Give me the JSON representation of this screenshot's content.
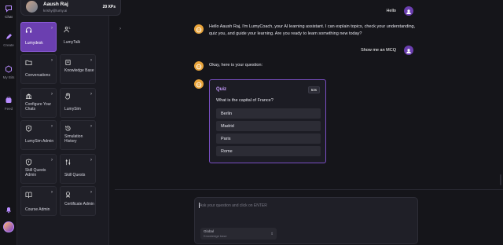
{
  "rail": {
    "items": [
      {
        "icon": "chat-icon",
        "label": "Chat"
      },
      {
        "icon": "pen-icon",
        "label": "Create"
      },
      {
        "icon": "cube-icon",
        "label": "My Bits"
      },
      {
        "icon": "feed-icon",
        "label": "Feed"
      }
    ],
    "accent": "#a970ff"
  },
  "user": {
    "name": "Aaush Raj",
    "handle": "krishy@lumy.ai",
    "xp": "20 XPs"
  },
  "tiles": [
    {
      "label": "Lumydesk",
      "icon": "headphones-icon",
      "active": true
    },
    {
      "label": "LumyTalk",
      "icon": "person-talk-icon"
    },
    {
      "label": "Conversations",
      "icon": "folder-icon"
    },
    {
      "label": "Knowledge Base",
      "icon": "book-icon"
    },
    {
      "label": "Configure Your Chats",
      "icon": "building-icon"
    },
    {
      "label": "LumySim",
      "icon": "hand-icon"
    },
    {
      "label": "LumySim Admin",
      "icon": "shield-icon"
    },
    {
      "label": "Simulation History",
      "icon": "history-icon"
    },
    {
      "label": "Skill Quests Admin",
      "icon": "shield-icon"
    },
    {
      "label": "Skill Quests",
      "icon": "sliders-icon"
    },
    {
      "label": "Course Admin",
      "icon": "open-book-icon"
    },
    {
      "label": "Certificate Admin",
      "icon": "certificate-icon"
    }
  ],
  "chat": {
    "messages": [
      {
        "from": "user",
        "text": "Hello"
      },
      {
        "from": "bot",
        "lines": [
          "Hello Aaush Raj, I'm LumyCoach, your AI learning assistant. I can explain topics, check your understanding,",
          "quiz you, and guide your learning. Are you ready to learn something new today?"
        ]
      },
      {
        "from": "user",
        "text": "Show me an MCQ"
      },
      {
        "from": "bot",
        "lines": [
          "Okay, here is your question:"
        ]
      }
    ],
    "quiz": {
      "title": "Quiz",
      "timer": "53s",
      "question": "What is the capital of France?",
      "options": [
        "Berlin",
        "Madrid",
        "Paris",
        "Rome"
      ]
    }
  },
  "input": {
    "placeholder": "Ask your question and click on ENTER",
    "selector_label": "Global",
    "selector_value": "Knowledge base"
  },
  "colors": {
    "purple": "#6b3fb0",
    "orange": "#e9a43b",
    "bg": "#15151a"
  }
}
